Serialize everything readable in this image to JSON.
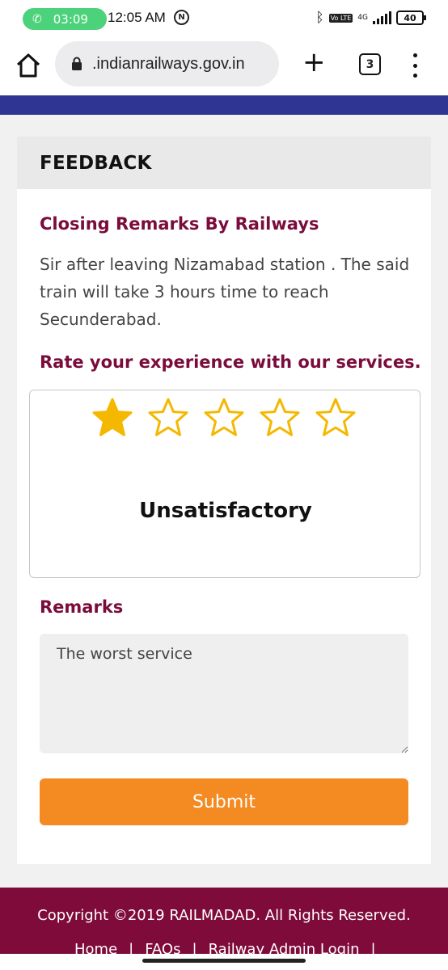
{
  "status_bar": {
    "call_timer": "03:09",
    "time": "12:05 AM",
    "network": "4G",
    "volte": "Vo LTE",
    "battery": "40"
  },
  "browser": {
    "url": ".indianrailways.gov.in",
    "tab_count": "3"
  },
  "feedback": {
    "header": "FEEDBACK",
    "closing_heading": "Closing Remarks By Railways",
    "closing_text": "Sir after leaving Nizamabad station . The said train will take 3 hours time to reach Secunderabad.",
    "rate_heading": "Rate your experience with our services.",
    "rating": {
      "value": 1,
      "max": 5,
      "label": "Unsatisfactory"
    },
    "remarks_heading": "Remarks",
    "remarks_value": "The worst service",
    "submit_label": "Submit"
  },
  "footer": {
    "copyright": "Copyright ©2019 RAILMADAD. All Rights Reserved.",
    "links": [
      "Home",
      "FAQs",
      "Railway Admin Login"
    ]
  },
  "colors": {
    "accent": "#7a0c3c",
    "submit": "#f48a22",
    "star": "#f5b800",
    "band": "#2e3592",
    "footer": "#7e0b3a"
  }
}
